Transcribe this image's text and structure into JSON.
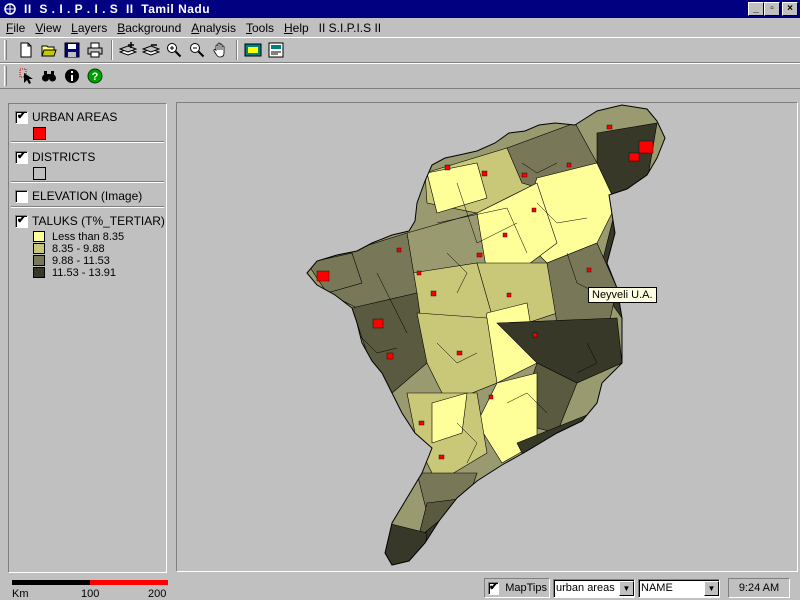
{
  "window": {
    "title": "II  S . I . P . I . S  II  Tamil Nadu",
    "buttons": {
      "minimize": "_",
      "maximize": "▫",
      "close": "×"
    }
  },
  "menu": [
    "File",
    "View",
    "Layers",
    "Background",
    "Analysis",
    "Tools",
    "Help",
    "II S.I.P.I.S II"
  ],
  "menu_mnemonics": [
    "F",
    "V",
    "L",
    "B",
    "A",
    "T",
    "H",
    ""
  ],
  "toolbar1": [
    "new-icon",
    "open-icon",
    "save-icon",
    "print-icon",
    "add-layer-icon",
    "remove-layer-icon",
    "zoom-in-icon",
    "zoom-out-icon",
    "pan-hand-icon",
    "full-extent-icon",
    "properties-icon"
  ],
  "toolbar2": [
    "select-feature-icon",
    "find-binoculars-icon",
    "info-icon",
    "help-icon"
  ],
  "legend": {
    "layers": [
      {
        "name": "URBAN AREAS",
        "checked": true,
        "swatch": "#ff0000"
      },
      {
        "name": "DISTRICTS",
        "checked": true,
        "swatch": "#c0c0c0"
      },
      {
        "name": "ELEVATION (Image)",
        "checked": false
      },
      {
        "name": "TALUKS (T%_TERTIAR)",
        "checked": true
      }
    ],
    "classes": [
      {
        "label": "Less than 8.35",
        "color": "#ffff99"
      },
      {
        "label": "8.35 - 9.88",
        "color": "#c8c878"
      },
      {
        "label": "9.88 - 11.53",
        "color": "#787858"
      },
      {
        "label": "11.53 - 13.91",
        "color": "#383828"
      }
    ]
  },
  "map": {
    "maptip": "Neyveli U.A.",
    "urban_color": "#ff0000"
  },
  "scalebar": {
    "unit": "Km",
    "mid": "100",
    "max": "200"
  },
  "status": {
    "maptips_checked": true,
    "maptips_label": "MapTips",
    "layer_select": "urban areas",
    "field_select": "NAME",
    "time": "9:24 AM"
  }
}
